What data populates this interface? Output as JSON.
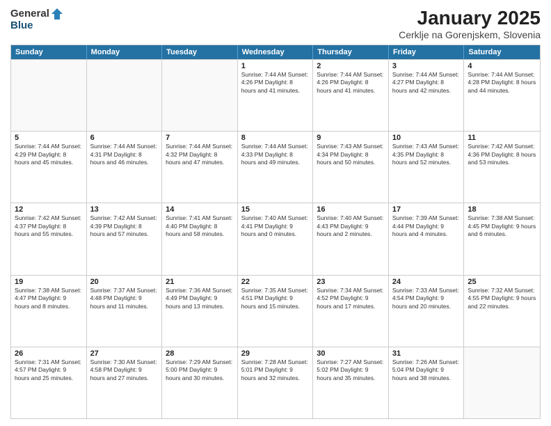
{
  "logo": {
    "general": "General",
    "blue": "Blue"
  },
  "title": "January 2025",
  "subtitle": "Cerklje na Gorenjskem, Slovenia",
  "days": [
    "Sunday",
    "Monday",
    "Tuesday",
    "Wednesday",
    "Thursday",
    "Friday",
    "Saturday"
  ],
  "weeks": [
    [
      {
        "day": "",
        "info": ""
      },
      {
        "day": "",
        "info": ""
      },
      {
        "day": "",
        "info": ""
      },
      {
        "day": "1",
        "info": "Sunrise: 7:44 AM\nSunset: 4:26 PM\nDaylight: 8 hours and 41 minutes."
      },
      {
        "day": "2",
        "info": "Sunrise: 7:44 AM\nSunset: 4:26 PM\nDaylight: 8 hours and 41 minutes."
      },
      {
        "day": "3",
        "info": "Sunrise: 7:44 AM\nSunset: 4:27 PM\nDaylight: 8 hours and 42 minutes."
      },
      {
        "day": "4",
        "info": "Sunrise: 7:44 AM\nSunset: 4:28 PM\nDaylight: 8 hours and 44 minutes."
      }
    ],
    [
      {
        "day": "5",
        "info": "Sunrise: 7:44 AM\nSunset: 4:29 PM\nDaylight: 8 hours and 45 minutes."
      },
      {
        "day": "6",
        "info": "Sunrise: 7:44 AM\nSunset: 4:31 PM\nDaylight: 8 hours and 46 minutes."
      },
      {
        "day": "7",
        "info": "Sunrise: 7:44 AM\nSunset: 4:32 PM\nDaylight: 8 hours and 47 minutes."
      },
      {
        "day": "8",
        "info": "Sunrise: 7:44 AM\nSunset: 4:33 PM\nDaylight: 8 hours and 49 minutes."
      },
      {
        "day": "9",
        "info": "Sunrise: 7:43 AM\nSunset: 4:34 PM\nDaylight: 8 hours and 50 minutes."
      },
      {
        "day": "10",
        "info": "Sunrise: 7:43 AM\nSunset: 4:35 PM\nDaylight: 8 hours and 52 minutes."
      },
      {
        "day": "11",
        "info": "Sunrise: 7:42 AM\nSunset: 4:36 PM\nDaylight: 8 hours and 53 minutes."
      }
    ],
    [
      {
        "day": "12",
        "info": "Sunrise: 7:42 AM\nSunset: 4:37 PM\nDaylight: 8 hours and 55 minutes."
      },
      {
        "day": "13",
        "info": "Sunrise: 7:42 AM\nSunset: 4:39 PM\nDaylight: 8 hours and 57 minutes."
      },
      {
        "day": "14",
        "info": "Sunrise: 7:41 AM\nSunset: 4:40 PM\nDaylight: 8 hours and 58 minutes."
      },
      {
        "day": "15",
        "info": "Sunrise: 7:40 AM\nSunset: 4:41 PM\nDaylight: 9 hours and 0 minutes."
      },
      {
        "day": "16",
        "info": "Sunrise: 7:40 AM\nSunset: 4:43 PM\nDaylight: 9 hours and 2 minutes."
      },
      {
        "day": "17",
        "info": "Sunrise: 7:39 AM\nSunset: 4:44 PM\nDaylight: 9 hours and 4 minutes."
      },
      {
        "day": "18",
        "info": "Sunrise: 7:38 AM\nSunset: 4:45 PM\nDaylight: 9 hours and 6 minutes."
      }
    ],
    [
      {
        "day": "19",
        "info": "Sunrise: 7:38 AM\nSunset: 4:47 PM\nDaylight: 9 hours and 8 minutes."
      },
      {
        "day": "20",
        "info": "Sunrise: 7:37 AM\nSunset: 4:48 PM\nDaylight: 9 hours and 11 minutes."
      },
      {
        "day": "21",
        "info": "Sunrise: 7:36 AM\nSunset: 4:49 PM\nDaylight: 9 hours and 13 minutes."
      },
      {
        "day": "22",
        "info": "Sunrise: 7:35 AM\nSunset: 4:51 PM\nDaylight: 9 hours and 15 minutes."
      },
      {
        "day": "23",
        "info": "Sunrise: 7:34 AM\nSunset: 4:52 PM\nDaylight: 9 hours and 17 minutes."
      },
      {
        "day": "24",
        "info": "Sunrise: 7:33 AM\nSunset: 4:54 PM\nDaylight: 9 hours and 20 minutes."
      },
      {
        "day": "25",
        "info": "Sunrise: 7:32 AM\nSunset: 4:55 PM\nDaylight: 9 hours and 22 minutes."
      }
    ],
    [
      {
        "day": "26",
        "info": "Sunrise: 7:31 AM\nSunset: 4:57 PM\nDaylight: 9 hours and 25 minutes."
      },
      {
        "day": "27",
        "info": "Sunrise: 7:30 AM\nSunset: 4:58 PM\nDaylight: 9 hours and 27 minutes."
      },
      {
        "day": "28",
        "info": "Sunrise: 7:29 AM\nSunset: 5:00 PM\nDaylight: 9 hours and 30 minutes."
      },
      {
        "day": "29",
        "info": "Sunrise: 7:28 AM\nSunset: 5:01 PM\nDaylight: 9 hours and 32 minutes."
      },
      {
        "day": "30",
        "info": "Sunrise: 7:27 AM\nSunset: 5:02 PM\nDaylight: 9 hours and 35 minutes."
      },
      {
        "day": "31",
        "info": "Sunrise: 7:26 AM\nSunset: 5:04 PM\nDaylight: 9 hours and 38 minutes."
      },
      {
        "day": "",
        "info": ""
      }
    ]
  ]
}
